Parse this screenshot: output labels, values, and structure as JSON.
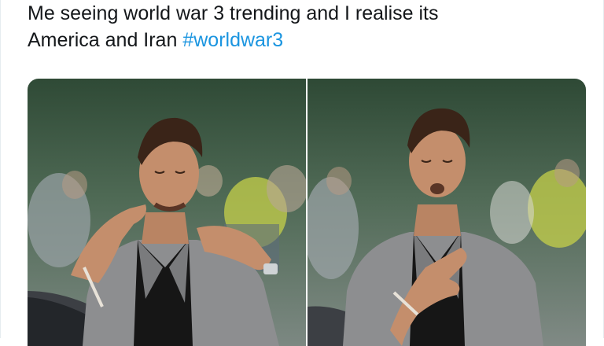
{
  "tweet": {
    "text_line1": "Me seeing world war 3 trending and I realise its",
    "text_line2_prefix": "America and Iran ",
    "hashtag": "#worldwar3"
  },
  "media": {
    "photos": [
      {
        "icon": "relieved-man-photo-left"
      },
      {
        "icon": "relieved-man-photo-right"
      }
    ]
  },
  "colors": {
    "hashtag": "#1b95e0",
    "text": "#14171a",
    "jacket": "#8d8e90",
    "shirt": "#161616",
    "skin": "#c48e6c"
  }
}
